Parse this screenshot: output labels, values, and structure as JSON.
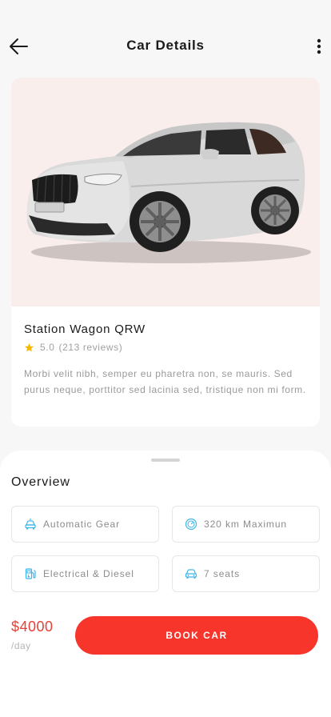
{
  "header": {
    "title": "Car Details",
    "back_icon": "arrow-left-icon",
    "menu_icon": "more-vertical-icon"
  },
  "car": {
    "image_icon": "car-photo",
    "name": "Station Wagon QRW",
    "rating": "5.0",
    "reviews": "(213 reviews)",
    "description": "Morbi velit nibh, semper eu pharetra non, se mauris. Sed purus neque, porttitor sed lacinia sed, tristique non mi form."
  },
  "overview": {
    "title": "Overview",
    "features": [
      {
        "label": "Automatic Gear",
        "icon": "car-gear-icon"
      },
      {
        "label": "320 km Maximun",
        "icon": "speedometer-icon"
      },
      {
        "label": "Electrical & Diesel",
        "icon": "fuel-pump-icon"
      },
      {
        "label": "7 seats",
        "icon": "car-seats-icon"
      }
    ]
  },
  "booking": {
    "price": "$4000",
    "period": "/day",
    "button_label": "BOOK CAR"
  },
  "colors": {
    "accent": "#f7352b",
    "price": "#e8413a",
    "icon_blue": "#3fb6e8",
    "star": "#f5b800",
    "image_bg": "#faeeec"
  }
}
